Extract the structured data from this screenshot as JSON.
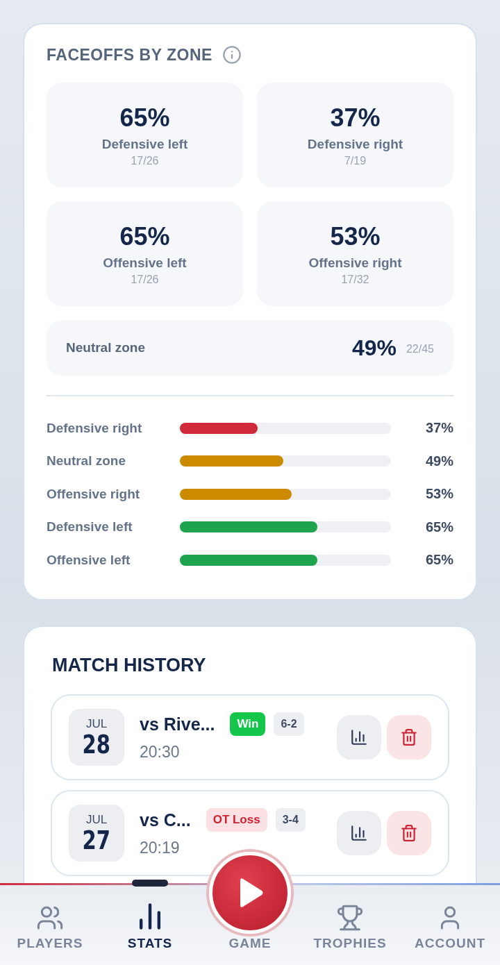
{
  "faceoffs": {
    "title": "FACEOFFS BY ZONE",
    "tiles": [
      {
        "percent": "65%",
        "label": "Defensive left",
        "count": "17/26"
      },
      {
        "percent": "37%",
        "label": "Defensive right",
        "count": "7/19"
      },
      {
        "percent": "65%",
        "label": "Offensive left",
        "count": "17/26"
      },
      {
        "percent": "53%",
        "label": "Offensive right",
        "count": "17/32"
      }
    ],
    "neutral": {
      "label": "Neutral zone",
      "percent": "49%",
      "count": "22/45"
    },
    "bars": [
      {
        "label": "Defensive right",
        "level": 0.37,
        "percent": "37%",
        "color": "#d12a3a"
      },
      {
        "label": "Neutral zone",
        "level": 0.49,
        "percent": "49%",
        "color": "#cc8a00"
      },
      {
        "label": "Offensive right",
        "level": 0.53,
        "percent": "53%",
        "color": "#cc8a00"
      },
      {
        "label": "Defensive left",
        "level": 0.65,
        "percent": "65%",
        "color": "#1ea34f"
      },
      {
        "label": "Offensive left",
        "level": 0.65,
        "percent": "65%",
        "color": "#1ea34f"
      }
    ]
  },
  "match_history": {
    "title": "MATCH HISTORY",
    "matches": [
      {
        "month": "JUL",
        "day": "28",
        "opponent": "vs Rive...",
        "time": "20:30",
        "result": "Win",
        "kind": "win",
        "score": "6-2"
      },
      {
        "month": "JUL",
        "day": "27",
        "opponent": "vs C...",
        "time": "20:19",
        "result": "OT Loss",
        "kind": "loss",
        "score": "3-4"
      }
    ]
  },
  "nav": [
    {
      "label": "PLAYERS",
      "kind": "players",
      "selected": false
    },
    {
      "label": "STATS",
      "kind": "stats",
      "selected": true
    },
    {
      "label": "GAME",
      "kind": "game",
      "selected": false
    },
    {
      "label": "TROPHIES",
      "kind": "trophies",
      "selected": false
    },
    {
      "label": "ACCOUNT",
      "kind": "account",
      "selected": false
    }
  ]
}
